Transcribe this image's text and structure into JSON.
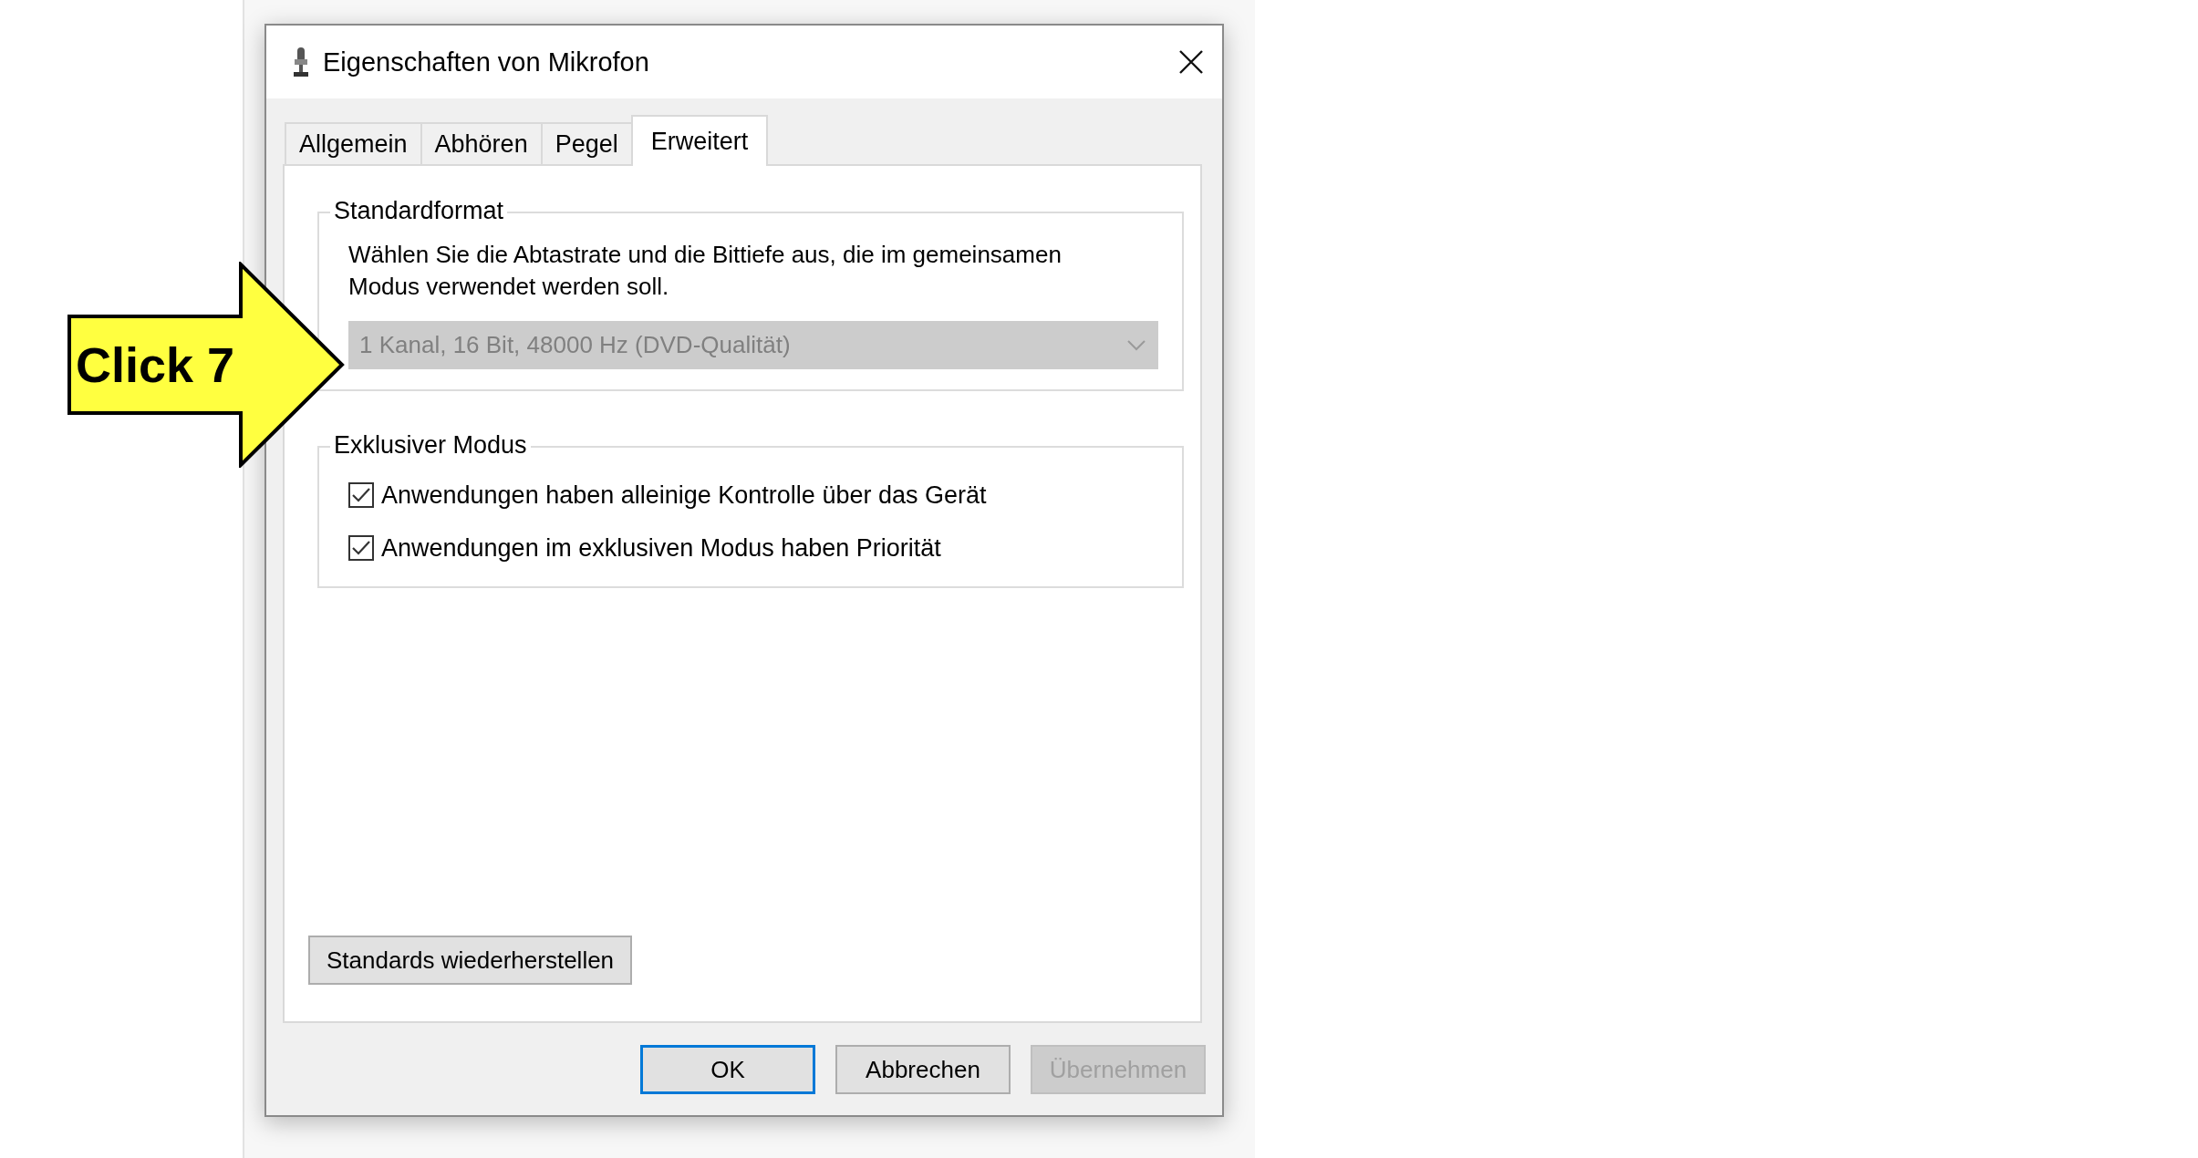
{
  "window": {
    "title": "Eigenschaften von Mikrofon"
  },
  "tabs": [
    {
      "label": "Allgemein",
      "selected": false
    },
    {
      "label": "Abhören",
      "selected": false
    },
    {
      "label": "Pegel",
      "selected": false
    },
    {
      "label": "Erweitert",
      "selected": true
    }
  ],
  "groups": [
    {
      "title": "Standardformat",
      "description": "Wählen Sie die Abtastrate und die Bittiefe aus, die im gemeinsamen Modus verwendet werden soll.",
      "dropdown": {
        "value": "1 Kanal, 16 Bit, 48000 Hz (DVD-Qualität)",
        "disabled": true
      }
    },
    {
      "title": "Exklusiver Modus",
      "checkboxes": [
        {
          "label": "Anwendungen haben alleinige Kontrolle über das Gerät",
          "checked": true
        },
        {
          "label": "Anwendungen im exklusiven Modus haben Priorität",
          "checked": true
        }
      ]
    }
  ],
  "restore_button": "Standards wiederherstellen",
  "buttons": [
    {
      "label": "OK",
      "default": true,
      "disabled": false
    },
    {
      "label": "Abbrechen",
      "default": false,
      "disabled": false
    },
    {
      "label": "Übernehmen",
      "default": false,
      "disabled": true
    }
  ],
  "callout": {
    "text": "Click 7"
  }
}
